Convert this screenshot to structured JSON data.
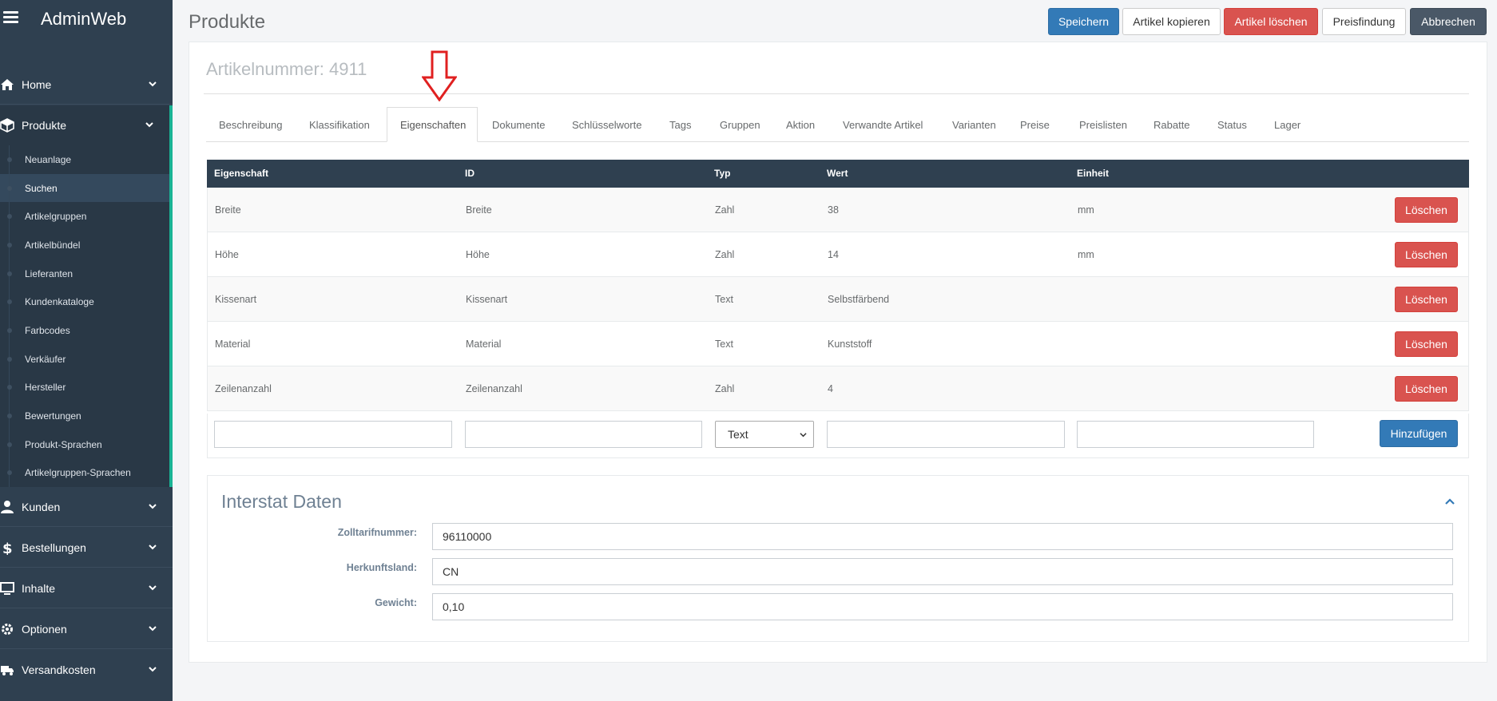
{
  "app": {
    "brand": "AdminWeb"
  },
  "sidebar": {
    "main_items": [
      {
        "label": "Home",
        "icon": "home-icon"
      },
      {
        "label": "Produkte",
        "icon": "cube-icon"
      },
      {
        "label": "Kunden",
        "icon": "user-icon"
      },
      {
        "label": "Bestellungen",
        "icon": "dollar-icon"
      },
      {
        "label": "Inhalte",
        "icon": "monitor-icon"
      },
      {
        "label": "Optionen",
        "icon": "gear-icon"
      },
      {
        "label": "Versandkosten",
        "icon": "truck-icon"
      }
    ],
    "sub_items": [
      {
        "label": "Neuanlage"
      },
      {
        "label": "Suchen"
      },
      {
        "label": "Artikelgruppen"
      },
      {
        "label": "Artikelbündel"
      },
      {
        "label": "Lieferanten"
      },
      {
        "label": "Kundenkataloge"
      },
      {
        "label": "Farbcodes"
      },
      {
        "label": "Verkäufer"
      },
      {
        "label": "Hersteller"
      },
      {
        "label": "Bewertungen"
      },
      {
        "label": "Produkt-Sprachen"
      },
      {
        "label": "Artikelgruppen-Sprachen"
      }
    ]
  },
  "header": {
    "title": "Produkte",
    "buttons": {
      "save": "Speichern",
      "copy": "Artikel kopieren",
      "delete": "Artikel löschen",
      "pricing": "Preisfindung",
      "cancel": "Abbrechen"
    }
  },
  "article": {
    "title": "Artikelnummer: 4911"
  },
  "tabs": [
    {
      "label": "Beschreibung"
    },
    {
      "label": "Klassifikation"
    },
    {
      "label": "Eigenschaften"
    },
    {
      "label": "Dokumente"
    },
    {
      "label": "Schlüsselworte"
    },
    {
      "label": "Tags"
    },
    {
      "label": "Gruppen"
    },
    {
      "label": "Aktion"
    },
    {
      "label": "Verwandte Artikel"
    },
    {
      "label": "Varianten"
    },
    {
      "label": "Preise"
    },
    {
      "label": "Preislisten"
    },
    {
      "label": "Rabatte"
    },
    {
      "label": "Status"
    },
    {
      "label": "Lager"
    }
  ],
  "active_tab": "Eigenschaften",
  "table": {
    "headers": {
      "property": "Eigenschaft",
      "id": "ID",
      "type": "Typ",
      "value": "Wert",
      "unit": "Einheit"
    },
    "rows": [
      {
        "property": "Breite",
        "id": "Breite",
        "type": "Zahl",
        "value": "38",
        "unit": "mm",
        "action": "Löschen"
      },
      {
        "property": "Höhe",
        "id": "Höhe",
        "type": "Zahl",
        "value": "14",
        "unit": "mm",
        "action": "Löschen"
      },
      {
        "property": "Kissenart",
        "id": "Kissenart",
        "type": "Text",
        "value": "Selbstfärbend",
        "unit": "",
        "action": "Löschen"
      },
      {
        "property": "Material",
        "id": "Material",
        "type": "Text",
        "value": "Kunststoff",
        "unit": "",
        "action": "Löschen"
      },
      {
        "property": "Zeilenanzahl",
        "id": "Zeilenanzahl",
        "type": "Zahl",
        "value": "4",
        "unit": "",
        "action": "Löschen"
      }
    ],
    "new_row": {
      "type_selected": "Text",
      "add_label": "Hinzufügen"
    }
  },
  "interstat": {
    "title": "Interstat Daten",
    "fields": [
      {
        "label": "Zolltarifnummer:",
        "value": "96110000"
      },
      {
        "label": "Herkunftsland:",
        "value": "CN"
      },
      {
        "label": "Gewicht:",
        "value": "0,10"
      }
    ]
  },
  "colors": {
    "sidebar_bg": "#2f4050",
    "accent_green": "#1ab394",
    "primary": "#337ab7",
    "danger": "#d9534f",
    "arrow_red": "#e02020"
  }
}
